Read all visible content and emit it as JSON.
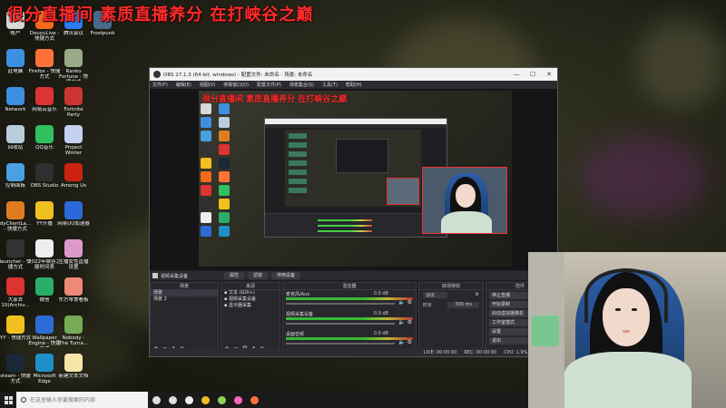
{
  "overlay": {
    "banner": "很分直播间 素质直播养分  在打峡谷之巅"
  },
  "desktop": {
    "column1": [
      {
        "label": "帐户",
        "icon": "user-icon",
        "color": "#d8d8d8"
      },
      {
        "label": "此电脑",
        "icon": "computer-icon",
        "color": "#3d8fe0"
      },
      {
        "label": "Network",
        "icon": "network-icon",
        "color": "#3d8fe0"
      },
      {
        "label": "回收站",
        "icon": "recycle-bin-icon",
        "color": "#bcd"
      },
      {
        "label": "控制面板",
        "icon": "control-panel-icon",
        "color": "#4aa0e0"
      },
      {
        "label": "dyClientLa... - 快捷方式",
        "icon": "dy-client-icon",
        "color": "#e07c20"
      },
      {
        "label": "launcher - 快捷方式",
        "icon": "launcher-icon",
        "color": "#333"
      },
      {
        "label": "大家去 10(Archiv...",
        "icon": "archive-icon",
        "color": "#d33"
      },
      {
        "label": "YY - 快捷方式",
        "icon": "yy-icon",
        "color": "#f0c020"
      },
      {
        "label": "steam - 快捷方式",
        "icon": "steam-icon",
        "color": "#1b2838"
      }
    ],
    "column2": [
      {
        "label": "DouyuLive - 快捷方式",
        "icon": "douyu-icon",
        "color": "#f46b1c"
      },
      {
        "label": "Firefox - 快捷方式",
        "icon": "firefox-icon",
        "color": "#ff7139"
      },
      {
        "label": "网易云音乐",
        "icon": "netease-music-icon",
        "color": "#d33"
      },
      {
        "label": "QQ音乐",
        "icon": "qq-music-icon",
        "color": "#30c060"
      },
      {
        "label": "OBS Studio",
        "icon": "obs-icon",
        "color": "#302e31"
      },
      {
        "label": "YY开播",
        "icon": "yy-live-icon",
        "color": "#f0c020"
      },
      {
        "label": "2022年峡谷之巅时间表",
        "icon": "document-icon",
        "color": "#eee"
      },
      {
        "label": "微信",
        "icon": "wechat-icon",
        "color": "#2aae67"
      },
      {
        "label": "Wallpaper Engine - 快捷方式",
        "icon": "wallpaper-engine-icon",
        "color": "#2c6bd6"
      },
      {
        "label": "Microsoft Edge",
        "icon": "edge-icon",
        "color": "#1e90c8"
      }
    ],
    "column3": [
      {
        "label": "腾讯会议",
        "icon": "tencent-meeting-icon",
        "color": "#2a7cf6"
      },
      {
        "label": "Ranko Fortune - 快捷方式",
        "icon": "ranko-icon",
        "color": "#9a8"
      },
      {
        "label": "Fortnite Party",
        "icon": "party-icon",
        "color": "#c33"
      },
      {
        "label": "Project Winter",
        "icon": "project-winter-icon",
        "color": "#c4d0f0"
      },
      {
        "label": "Among Us",
        "icon": "among-us-icon",
        "color": "#c21"
      },
      {
        "label": "网易UU加速器",
        "icon": "uu-accelerator-icon",
        "color": "#2a6ad8"
      },
      {
        "label": "主播女性直播设置",
        "icon": "streamer-setting-icon",
        "color": "#d9c"
      },
      {
        "label": "东方零食看板",
        "icon": "snack-board-icon",
        "color": "#e87"
      },
      {
        "label": "Nobody - The Turna...",
        "icon": "nobody-game-icon",
        "color": "#7a5"
      },
      {
        "label": "新建文本文档",
        "icon": "text-file-icon",
        "color": "#f6e6a8"
      }
    ],
    "column4": [
      {
        "label": "Frostpunk",
        "icon": "frostpunk-icon",
        "color": "#4a6a8a"
      }
    ]
  },
  "obs": {
    "title": "OBS 27.1.3 (64-bit, windows) - 配置文件: 未命名 - 场景: 未命名",
    "menu": [
      "文件(F)",
      "编辑(E)",
      "视图(V)",
      "停靠窗口(D)",
      "配置文件(P)",
      "场景集合(S)",
      "工具(T)",
      "帮助(H)"
    ],
    "preview_banner": "很分直播间 素质直播养分  在打峡谷之巅",
    "scene_bar": {
      "source_name": "视频采集设备",
      "properties": "属性",
      "filters": "滤镜",
      "deactivate": "停用设备"
    },
    "scenes": {
      "title": "场景",
      "items": [
        "场景",
        "场景 2"
      ],
      "selected": 0
    },
    "sources": {
      "title": "来源",
      "items": [
        {
          "label": "文本 (GDI+)",
          "icon": "text-source-icon"
        },
        {
          "label": "视频采集设备",
          "icon": "camera-source-icon"
        },
        {
          "label": "显示器采集",
          "icon": "monitor-source-icon"
        }
      ]
    },
    "mixer": {
      "title": "混音器",
      "tracks": [
        {
          "name": "麦克风/Aux",
          "db": "0.0 dB"
        },
        {
          "name": "视频采集设备",
          "db": "0.0 dB"
        },
        {
          "name": "桌面音频",
          "db": "0.0 dB"
        }
      ]
    },
    "transitions": {
      "title": "转场特效",
      "type": "淡出",
      "duration_label": "时长",
      "duration": "300 ms"
    },
    "controls": {
      "title": "控件",
      "buttons": [
        "停止直播",
        "开始录制",
        "启动虚拟摄像机",
        "工作室模式",
        "设置",
        "退出"
      ]
    },
    "status": {
      "live": "LIVE: 00:00:00",
      "rec": "REC: 00:00:00",
      "cpu": "CPU: 1.9%, 60.00 fps"
    }
  },
  "taskbar": {
    "search_placeholder": "在这里输入你要搜索的内容",
    "apps": [
      {
        "icon": "task-view-icon",
        "color": "#ddd"
      },
      {
        "icon": "widgets-icon",
        "color": "#ddd"
      },
      {
        "icon": "obs-taskbar-icon",
        "color": "#eee"
      },
      {
        "icon": "yy-taskbar-icon",
        "color": "#f0c020"
      },
      {
        "icon": "media-taskbar-icon",
        "color": "#8bd45a"
      },
      {
        "icon": "app-taskbar-icon",
        "color": "#f6b"
      },
      {
        "icon": "firefox-taskbar-icon",
        "color": "#ff7139"
      }
    ]
  }
}
